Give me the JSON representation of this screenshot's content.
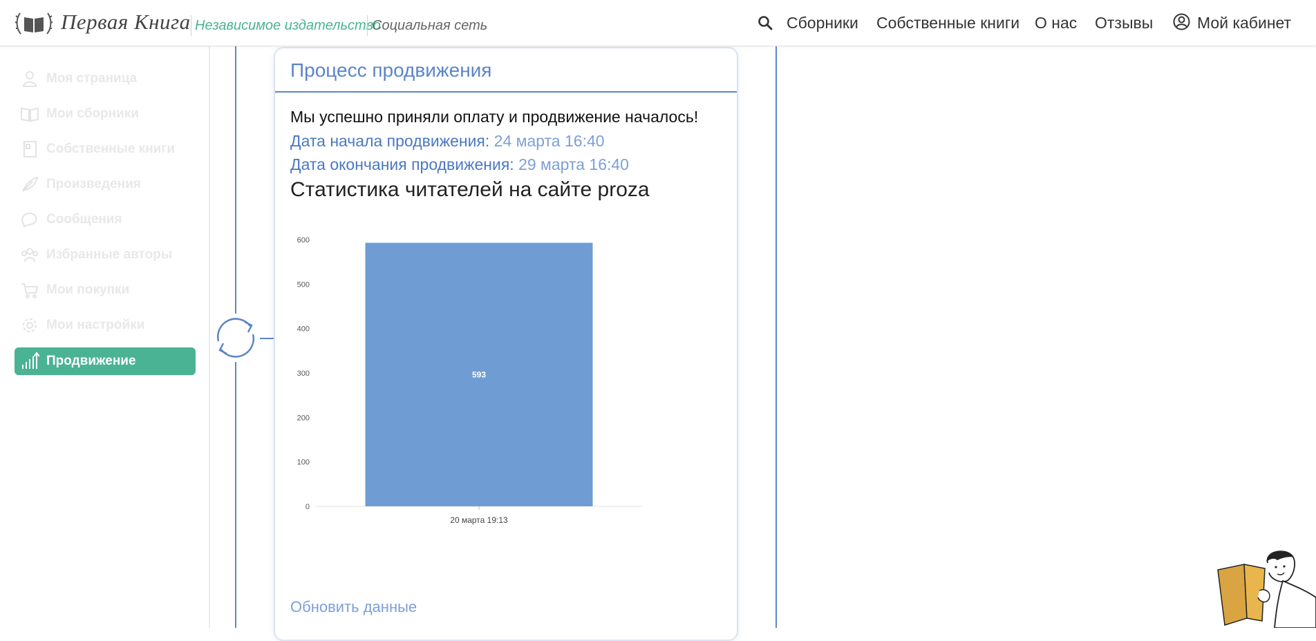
{
  "header": {
    "brand": "Первая Книга",
    "tagline1": "Независимое издательство",
    "tagline2": "Социальная сеть",
    "nav": [
      "Сборники",
      "Собственные книги",
      "О нас",
      "Отзывы"
    ],
    "account": "Мой кабинет"
  },
  "sidebar": {
    "items": [
      {
        "label": "Моя страница",
        "icon": "user-icon"
      },
      {
        "label": "Мои сборники",
        "icon": "book-icon"
      },
      {
        "label": "Собственные книги",
        "icon": "notebook-icon"
      },
      {
        "label": "Произведения",
        "icon": "feather-icon"
      },
      {
        "label": "Сообщения",
        "icon": "chat-icon"
      },
      {
        "label": "Избранные авторы",
        "icon": "group-icon"
      },
      {
        "label": "Мои покупки",
        "icon": "cart-icon"
      },
      {
        "label": "Мои настройки",
        "icon": "gear-icon"
      },
      {
        "label": "Продвижение",
        "icon": "chart-up-icon",
        "active": true
      }
    ]
  },
  "card": {
    "title": "Процесс продвижения",
    "message": "Мы успешно приняли оплату и продвижение началось!",
    "start_label": "Дата начала продвижения:",
    "start_value": "24 марта 16:40",
    "end_label": "Дата окончания продвижения:",
    "end_value": "29 марта 16:40",
    "stats_title": "Статистика читателей на сайте proza",
    "update_link": "Обновить данные"
  },
  "chart_data": {
    "type": "bar",
    "categories": [
      "20 марта 19:13"
    ],
    "values": [
      593
    ],
    "data_labels": [
      "593"
    ],
    "ylim": [
      0,
      600
    ],
    "yticks": [
      0,
      100,
      200,
      300,
      400,
      500,
      600
    ],
    "bar_color": "#6f9dd3",
    "grid": false
  },
  "colors": {
    "accent_green": "#49b393",
    "accent_blue": "#5b85c8",
    "bar": "#6f9dd3"
  }
}
